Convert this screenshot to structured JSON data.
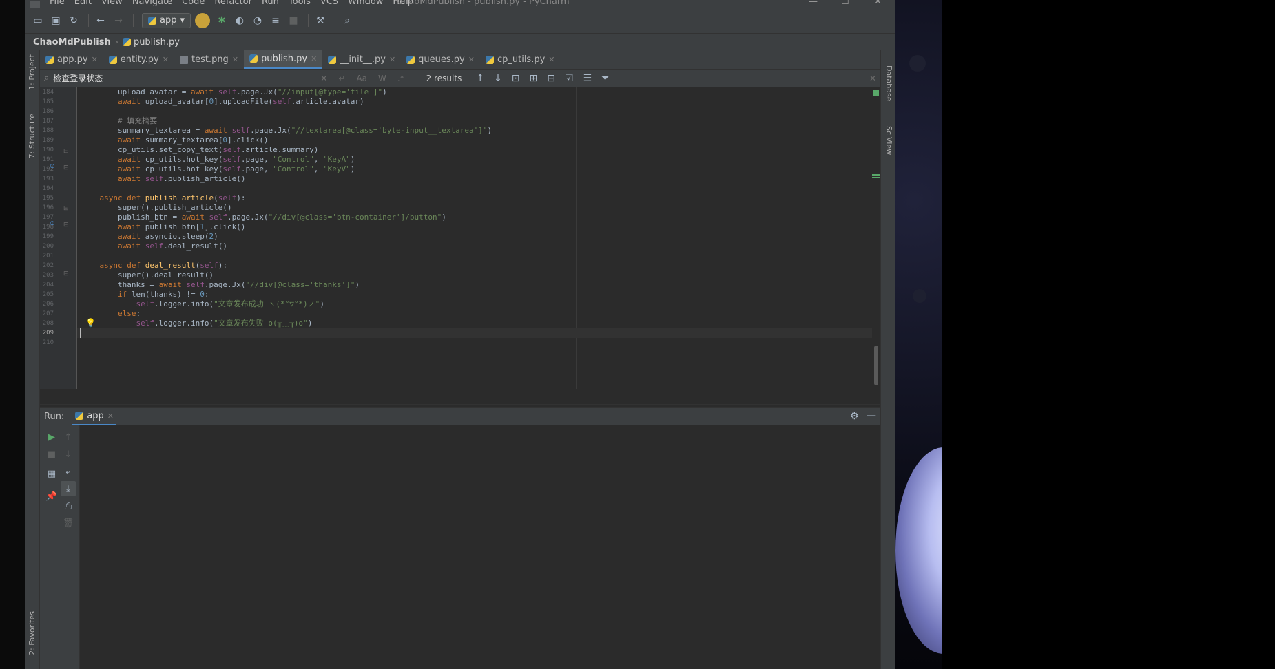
{
  "menu": {
    "items": [
      "File",
      "Edit",
      "View",
      "Navigate",
      "Code",
      "Refactor",
      "Run",
      "Tools",
      "VCS",
      "Window",
      "Help"
    ],
    "window_title": "ChaoMdPublish - publish.py - PyCharm",
    "minimize": "—",
    "maximize": "☐",
    "close": "✕"
  },
  "toolbar": {
    "run_config": "app",
    "icons": [
      "open-folder-icon",
      "save-icon",
      "sync-icon",
      "back-arrow-icon",
      "forward-arrow-icon",
      "run-icon",
      "debug-icon",
      "coverage-icon",
      "profile-icon",
      "concurrency-icon",
      "stop-icon",
      "settings-wrench-icon",
      "search-icon"
    ]
  },
  "breadcrumb": {
    "project": "ChaoMdPublish",
    "file": "publish.py"
  },
  "left_tools": {
    "project": "1: Project",
    "structure": "7: Structure",
    "favorites": "2: Favorites"
  },
  "right_tools": {
    "database": "Database",
    "sciview": "SciView"
  },
  "tabs": [
    {
      "label": "app.py",
      "icon": "python-file-icon"
    },
    {
      "label": "entity.py",
      "icon": "python-file-icon"
    },
    {
      "label": "test.png",
      "icon": "image-file-icon"
    },
    {
      "label": "publish.py",
      "icon": "python-file-icon",
      "active": true
    },
    {
      "label": "__init__.py",
      "icon": "python-file-icon"
    },
    {
      "label": "queues.py",
      "icon": "python-file-icon"
    },
    {
      "label": "cp_utils.py",
      "icon": "python-file-icon"
    }
  ],
  "find": {
    "query": "检查登录状态",
    "results": "2 results",
    "match_case": "Aa",
    "words": "W",
    "regex": ".*"
  },
  "code": [
    {
      "n": "184",
      "t": "        upload_avatar = await self.page.Jx(\"//input[@type='file']\")"
    },
    {
      "n": "185",
      "t": "        await upload_avatar[0].uploadFile(self.article.avatar)"
    },
    {
      "n": "186",
      "t": ""
    },
    {
      "n": "187",
      "t": "        # 填充摘要"
    },
    {
      "n": "188",
      "t": "        summary_textarea = await self.page.Jx(\"//textarea[@class='byte-input__textarea']\")"
    },
    {
      "n": "189",
      "t": "        await summary_textarea[0].click()"
    },
    {
      "n": "190",
      "t": "        cp_utils.set_copy_text(self.article.summary)"
    },
    {
      "n": "191",
      "t": "        await cp_utils.hot_key(self.page, \"Control\", \"KeyA\")"
    },
    {
      "n": "192",
      "t": "        await cp_utils.hot_key(self.page, \"Control\", \"KeyV\")"
    },
    {
      "n": "193",
      "t": "        await self.publish_article()"
    },
    {
      "n": "194",
      "t": ""
    },
    {
      "n": "195",
      "t": "    async def publish_article(self):"
    },
    {
      "n": "196",
      "t": "        super().publish_article()"
    },
    {
      "n": "197",
      "t": "        publish_btn = await self.page.Jx(\"//div[@class='btn-container']/button\")"
    },
    {
      "n": "198",
      "t": "        await publish_btn[1].click()"
    },
    {
      "n": "199",
      "t": "        await asyncio.sleep(2)"
    },
    {
      "n": "200",
      "t": "        await self.deal_result()"
    },
    {
      "n": "201",
      "t": ""
    },
    {
      "n": "202",
      "t": "    async def deal_result(self):"
    },
    {
      "n": "203",
      "t": "        super().deal_result()"
    },
    {
      "n": "204",
      "t": "        thanks = await self.page.Jx(\"//div[@class='thanks']\")"
    },
    {
      "n": "205",
      "t": "        if len(thanks) != 0:"
    },
    {
      "n": "206",
      "t": "            self.logger.info(\"文章发布成功 ヽ(*°▽°*)ノ\")"
    },
    {
      "n": "207",
      "t": "        else:"
    },
    {
      "n": "208",
      "t": "            self.logger.info(\"文章发布失败 o(╥﹏╥)o\")"
    },
    {
      "n": "209",
      "t": ""
    },
    {
      "n": "210",
      "t": ""
    }
  ],
  "run": {
    "label": "Run:",
    "tab": "app"
  }
}
